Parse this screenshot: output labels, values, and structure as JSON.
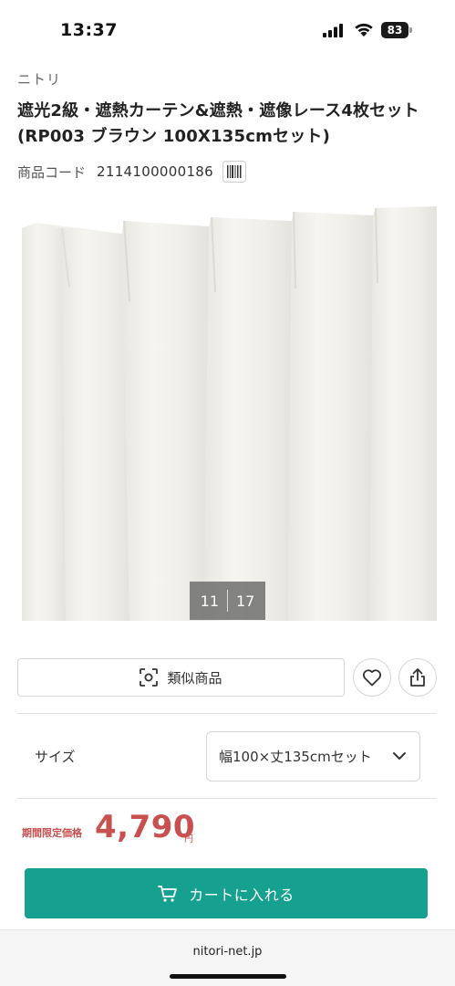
{
  "status_bar": {
    "time": "13:37",
    "battery_level": "83"
  },
  "product": {
    "brand": "ニトリ",
    "title": "遮光2級・遮熱カーテン&遮熱・遮像レース4枚セット(RP003 ブラウン 100X135cmセット)",
    "code_label": "商品コード",
    "code_value": "2114100000186"
  },
  "gallery": {
    "current": "11",
    "total": "17"
  },
  "actions": {
    "similar_label": "類似商品",
    "favorite_icon": "heart-icon",
    "share_icon": "share-icon"
  },
  "size": {
    "label": "サイズ",
    "selected": "幅100×丈135cmセット"
  },
  "price": {
    "label": "期間限定価格",
    "value": "4,790",
    "unit": "円",
    "color": "#c8504e"
  },
  "cart": {
    "label": "カートに入れる",
    "color": "#16a08f"
  },
  "browser": {
    "url": "nitori-net.jp"
  }
}
